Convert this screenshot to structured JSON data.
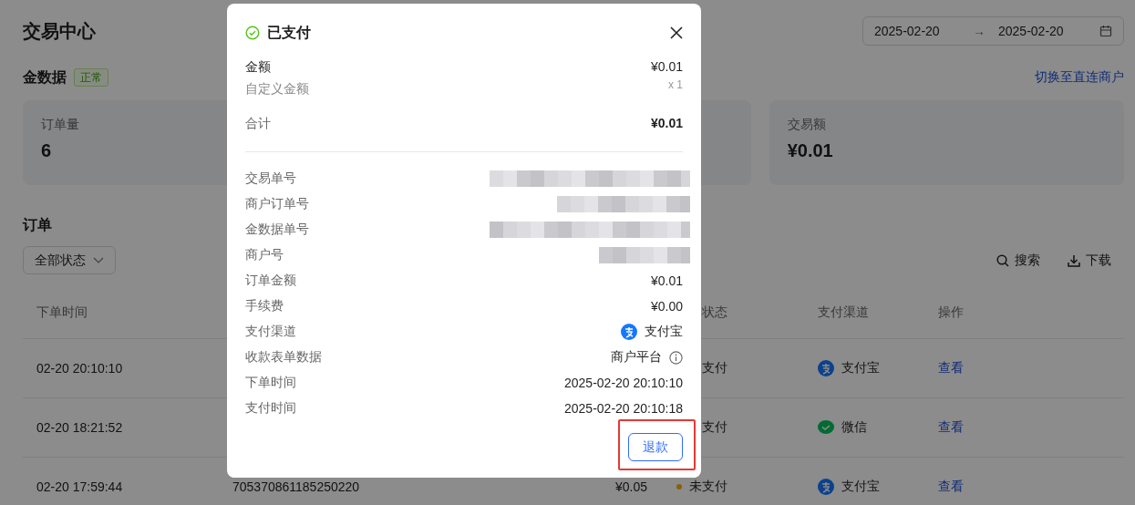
{
  "page": {
    "title": "交易中心",
    "date_range": {
      "start": "2025-02-20",
      "separator": "→",
      "end": "2025-02-20"
    }
  },
  "section": {
    "title": "金数据",
    "tag": "正常",
    "link": "切换至直连商户"
  },
  "stats": [
    {
      "kind": "metric",
      "label": "订单量",
      "value": "6"
    },
    {
      "kind": "covered"
    },
    {
      "kind": "metric",
      "label": "交易额",
      "value": "¥0.01"
    }
  ],
  "orders": {
    "title": "订单",
    "filter": "全部状态",
    "actions": [
      {
        "kind": "search",
        "label": "搜索"
      },
      {
        "kind": "download",
        "label": "下载"
      }
    ],
    "columns": [
      "下单时间",
      "状态",
      "支付渠道",
      "操作"
    ],
    "rows": [
      {
        "time": "02-20 20:10:10",
        "status": "支付",
        "status_dot": false,
        "channel": "支付宝",
        "kind": "alipay",
        "action": "查看"
      },
      {
        "time": "02-20 18:21:52",
        "status": "支付",
        "status_dot": false,
        "channel": "微信",
        "kind": "wechat",
        "action": "查看"
      },
      {
        "time": "02-20 17:59:44",
        "order_no": "705370861185250220",
        "amount": "¥0.05",
        "status": "未支付",
        "status_dot": true,
        "channel": "支付宝",
        "kind": "alipay",
        "action": "查看"
      }
    ]
  },
  "dialog": {
    "title": "已支付",
    "summary": [
      {
        "kind": "main",
        "label": "金额",
        "value": "¥0.01"
      },
      {
        "kind": "sub",
        "label": "自定义金额",
        "value": "x 1"
      },
      {
        "kind": "total",
        "label": "合计",
        "value": "¥0.01"
      }
    ],
    "details": [
      {
        "kind": "redacted",
        "label": "交易单号"
      },
      {
        "kind": "redacted",
        "label": "商户订单号"
      },
      {
        "kind": "redacted",
        "label": "金数据单号"
      },
      {
        "kind": "redacted",
        "label": "商户号"
      },
      {
        "kind": "text",
        "label": "订单金额",
        "value": "¥0.01"
      },
      {
        "kind": "text",
        "label": "手续费",
        "value": "¥0.00"
      },
      {
        "kind": "alipay",
        "label": "支付渠道",
        "value": "支付宝"
      },
      {
        "kind": "info",
        "label": "收款表单数据",
        "value": "商户平台"
      },
      {
        "kind": "text",
        "label": "下单时间",
        "value": "2025-02-20 20:10:10"
      },
      {
        "kind": "text",
        "label": "支付时间",
        "value": "2025-02-20 20:10:18"
      }
    ],
    "button": {
      "label": "退款",
      "highlighted": true
    }
  }
}
